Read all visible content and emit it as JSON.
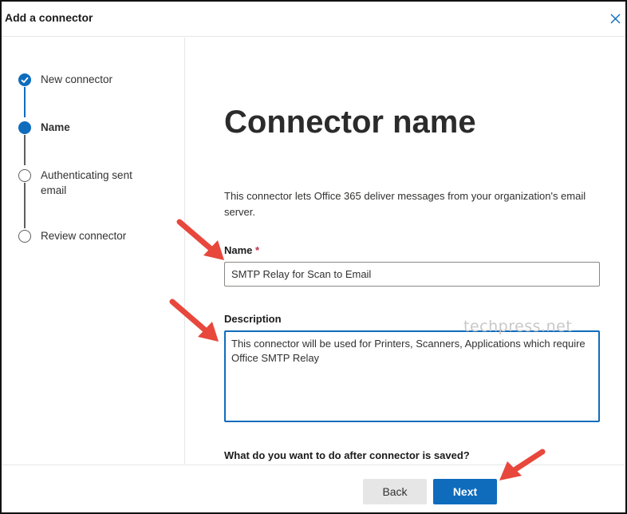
{
  "window": {
    "title": "Add a connector",
    "close_icon": "close-icon"
  },
  "steps": [
    {
      "label": "New connector",
      "state": "done"
    },
    {
      "label": "Name",
      "state": "current"
    },
    {
      "label": "Authenticating sent email",
      "state": "todo"
    },
    {
      "label": "Review connector",
      "state": "todo"
    }
  ],
  "main": {
    "heading": "Connector name",
    "description": "This connector lets Office 365 deliver messages from your organization's email server.",
    "name_label": "Name",
    "required_mark": "*",
    "name_value": "SMTP Relay for Scan to Email",
    "description_label": "Description",
    "description_value": "This connector will be used for Printers, Scanners, Applications which require Office SMTP Relay",
    "question": "What do you want to do after connector is saved?"
  },
  "watermark": "techpress.net",
  "footer": {
    "back_label": "Back",
    "next_label": "Next"
  },
  "colors": {
    "accent": "#0f6cbd",
    "arrow": "#e8473c",
    "required": "#c4314b"
  }
}
